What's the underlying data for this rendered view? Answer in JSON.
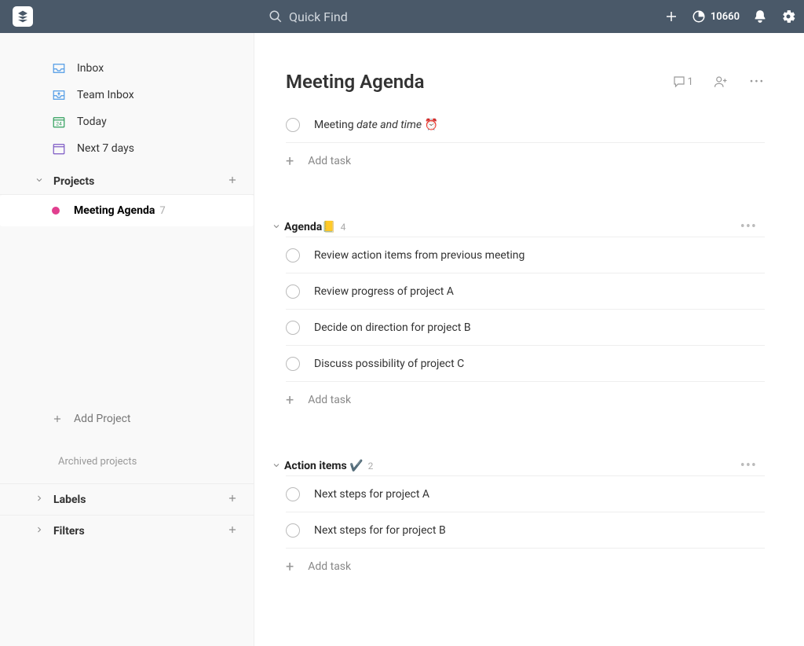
{
  "topbar": {
    "search_placeholder": "Quick Find",
    "karma_points": "10660"
  },
  "sidebar": {
    "nav": {
      "inbox": "Inbox",
      "team_inbox": "Team Inbox",
      "today": "Today",
      "next7": "Next 7 days"
    },
    "projects_header": "Projects",
    "projects": [
      {
        "label": "Meeting Agenda",
        "count": "7",
        "color": "#e13f8f"
      }
    ],
    "add_project": "Add Project",
    "archived_label": "Archived projects",
    "labels_header": "Labels",
    "filters_header": "Filters"
  },
  "main": {
    "title": "Meeting Agenda",
    "comment_count": "1",
    "top_tasks": [
      {
        "prefix": "Meeting ",
        "italic": "date and time",
        "emoji": " ⏰"
      }
    ],
    "add_task_label": "Add task",
    "sections": [
      {
        "name": "Agenda",
        "emoji": "📒",
        "count": "4",
        "tasks": [
          "Review action items from previous meeting",
          "Review progress of project A",
          "Decide on direction for project B",
          "Discuss possibility of project C"
        ]
      },
      {
        "name": "Action items",
        "emoji": "✔️",
        "count": "2",
        "tasks": [
          "Next steps for project A",
          "Next steps for for project B"
        ]
      }
    ]
  }
}
